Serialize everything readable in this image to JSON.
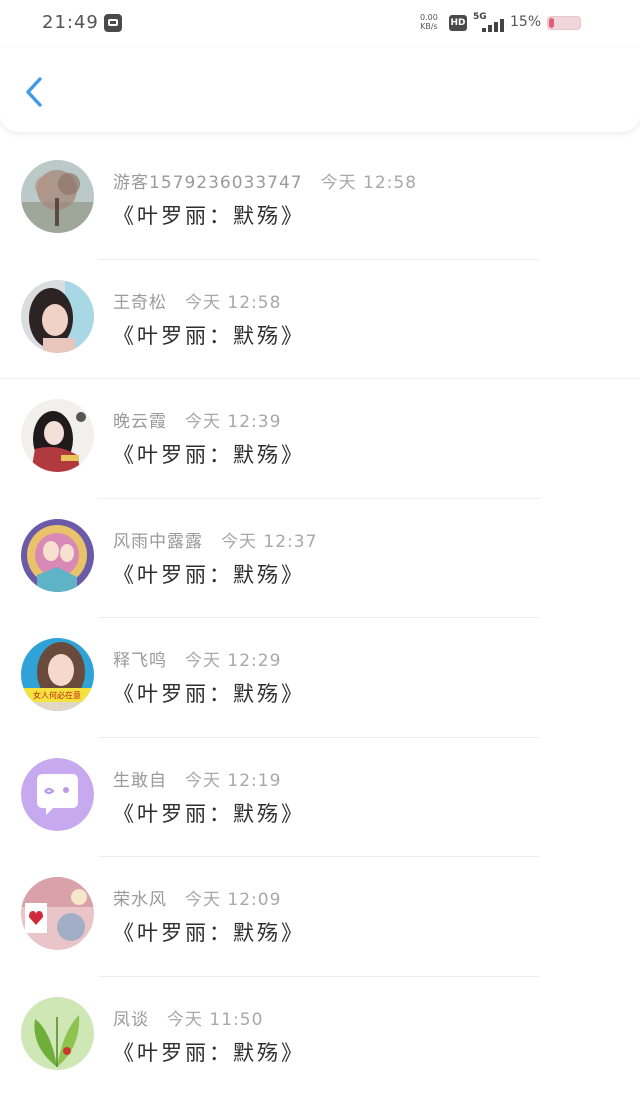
{
  "status_bar": {
    "time": "21:49",
    "net_speed_value": "0.00",
    "net_speed_unit": "KB/s",
    "hd": "HD",
    "network": "5G",
    "battery_percent": "15%",
    "battery_level": 0.15
  },
  "messages": [
    {
      "name": "游客15792360337​47",
      "time": "今天 12:58",
      "text": "《叶罗丽：默殇》"
    },
    {
      "name": "王奇松",
      "time": "今天 12:58",
      "text": "《叶罗丽：默殇》"
    },
    {
      "name": "晚云霞",
      "time": "今天 12:39",
      "text": "《叶罗丽：默殇》"
    },
    {
      "name": "风雨中露露",
      "time": "今天 12:37",
      "text": "《叶罗丽：默殇》"
    },
    {
      "name": "释飞鸣",
      "time": "今天 12:29",
      "text": "《叶罗丽：默殇》"
    },
    {
      "name": "生敢自",
      "time": "今天 12:19",
      "text": "《叶罗丽：默殇》"
    },
    {
      "name": "荣水风",
      "time": "今天 12:09",
      "text": "《叶罗丽：默殇》"
    },
    {
      "name": "凤谈",
      "time": "今天 11:50",
      "text": "《叶罗丽：默殇》"
    }
  ],
  "avatar_5_caption": "女人何必在意",
  "colors": {
    "accent": "#3d9be9",
    "name_text": "#9a9a9a",
    "message_text": "#2e2e2e"
  }
}
